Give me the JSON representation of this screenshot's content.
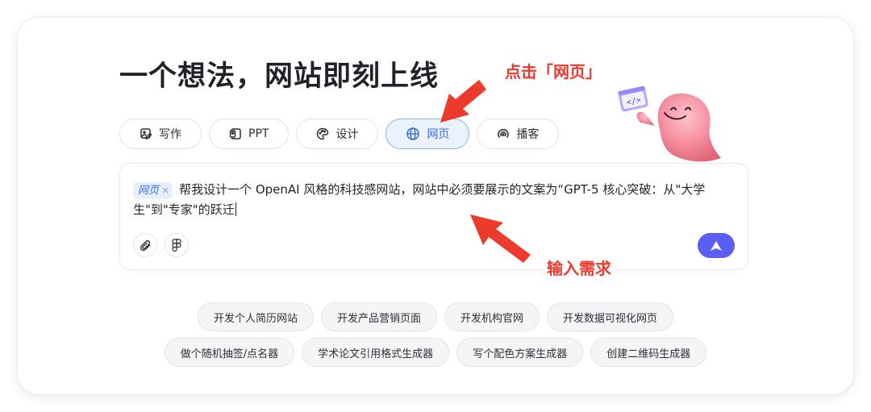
{
  "headline": "一个想法，网站即刻上线",
  "tabs": [
    {
      "label": "写作",
      "icon": "image-pen-icon"
    },
    {
      "label": "PPT",
      "icon": "slides-icon"
    },
    {
      "label": "设计",
      "icon": "palette-icon"
    },
    {
      "label": "网页",
      "icon": "globe-icon",
      "active": true
    },
    {
      "label": "播客",
      "icon": "podcast-icon"
    }
  ],
  "prompt": {
    "chip_label": "网页",
    "chip_remove": "×",
    "text": "帮我设计一个 OpenAI 风格的科技感网站，网站中必须要展示的文案为“GPT-5 核心突破：从\"大学生\"到\"专家\"的跃迁"
  },
  "suggestions_row1": [
    "开发个人简历网站",
    "开发产品营销页面",
    "开发机构官网",
    "开发数据可视化网页"
  ],
  "suggestions_row2": [
    "做个随机抽签/点名器",
    "学术论文引用格式生成器",
    "写个配色方案生成器",
    "创建二维码生成器"
  ],
  "annotations": {
    "click_tab": "点击「网页」",
    "enter_request": "输入需求"
  },
  "colors": {
    "accent": "#5b5ef5",
    "active_tab_bg": "#eaf2fe",
    "active_tab_text": "#3b6fe0",
    "annotation_red": "#ec3a2d"
  }
}
